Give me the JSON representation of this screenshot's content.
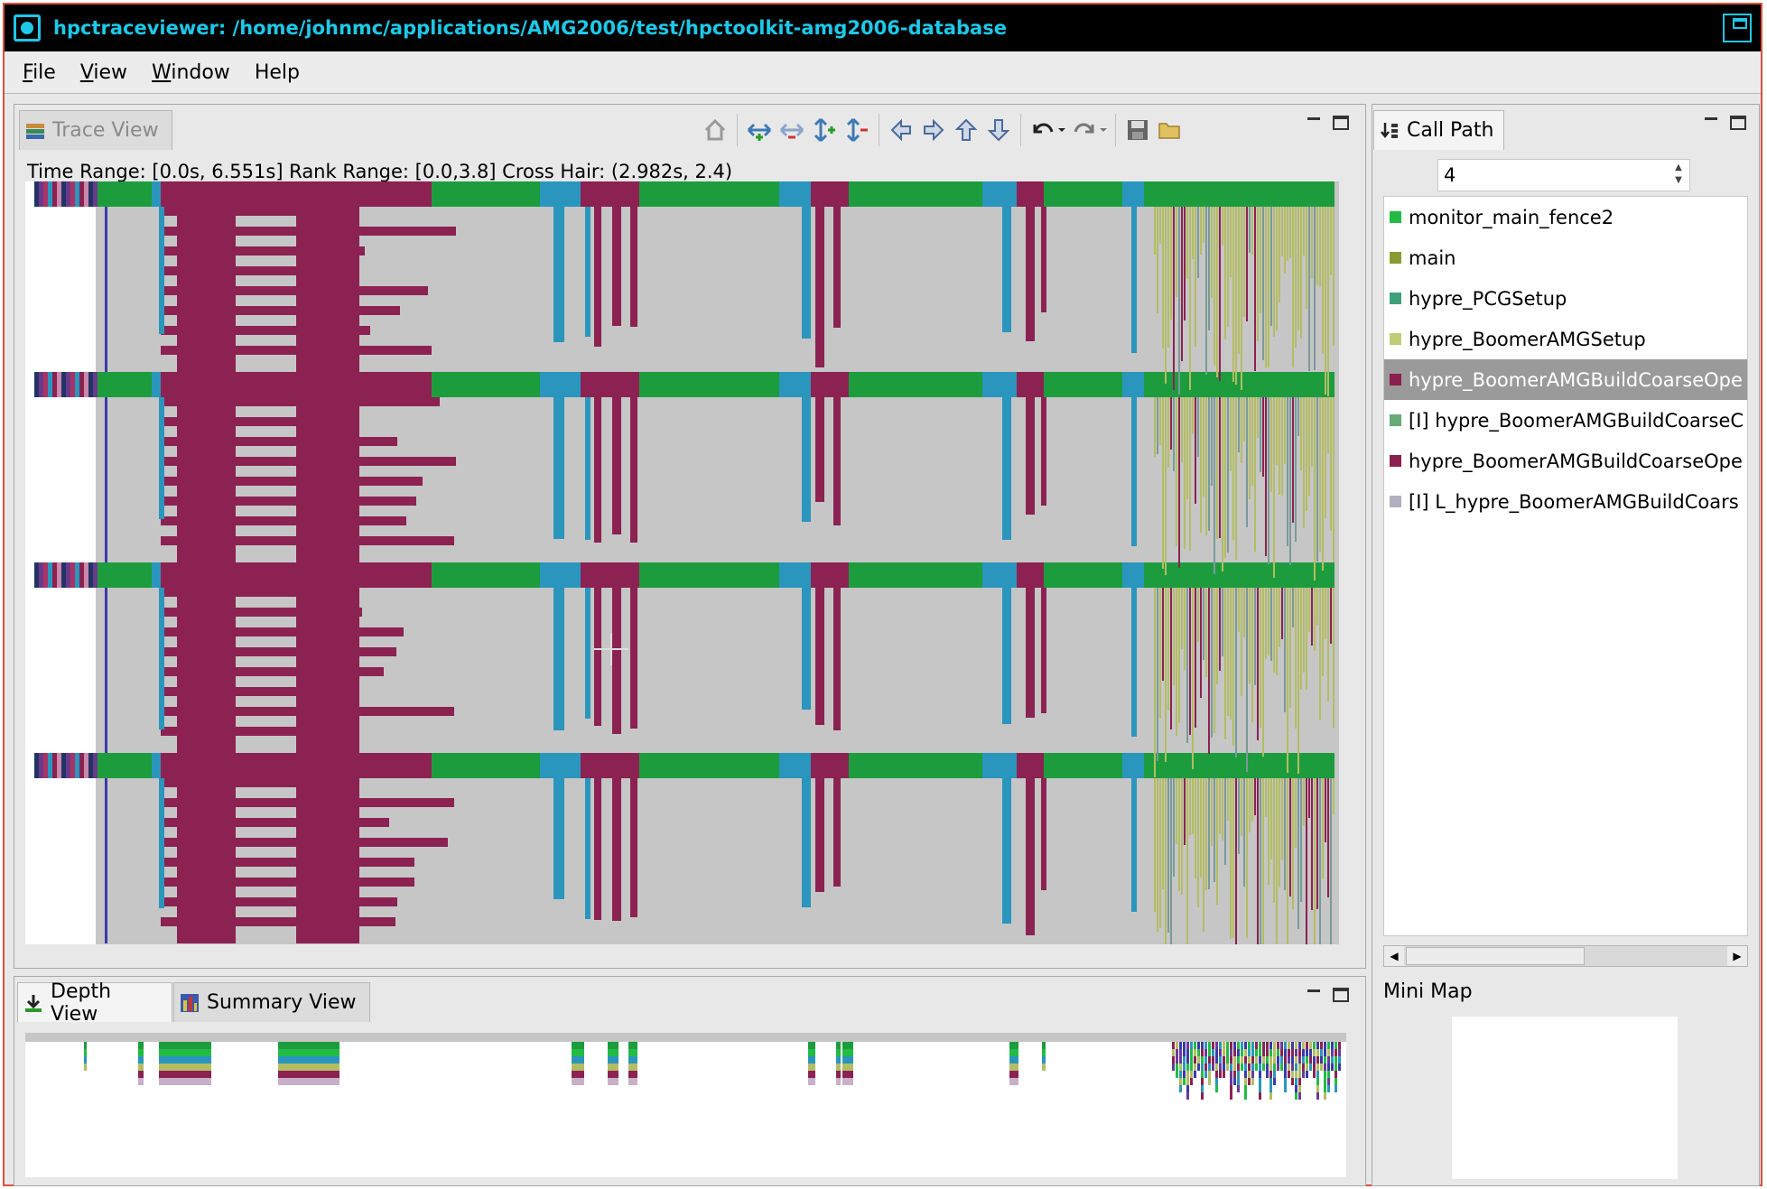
{
  "window": {
    "title": "hpctraceviewer: /home/johnmc/applications/AMG2006/test/hpctoolkit-amg2006-database"
  },
  "menu": [
    {
      "mnemonic": "F",
      "rest": "ile"
    },
    {
      "mnemonic": "V",
      "rest": "iew"
    },
    {
      "mnemonic": "W",
      "rest": "indow"
    },
    {
      "mnemonic": "",
      "rest": "Help"
    }
  ],
  "trace_view": {
    "tab_label": "Trace View",
    "info": "Time Range: [0.0s, 6.551s]  Rank Range: [0.0,3.8]  Cross Hair: (2.982s, 2.4)"
  },
  "lower_tabs": {
    "depth": "Depth View",
    "summary": "Summary View"
  },
  "call_path": {
    "tab_label": "Call Path",
    "depth_value": "4",
    "items": [
      {
        "label": "monitor_main_fence2",
        "color": "#22bb44",
        "selected": false
      },
      {
        "label": "main",
        "color": "#8a9b33",
        "selected": false
      },
      {
        "label": "hypre_PCGSetup",
        "color": "#3fa079",
        "selected": false
      },
      {
        "label": "hypre_BoomerAMGSetup",
        "color": "#c2cc77",
        "selected": false
      },
      {
        "label": "hypre_BoomerAMGBuildCoarseOpe",
        "color": "#8b1f4f",
        "selected": true
      },
      {
        "label": "[I] hypre_BoomerAMGBuildCoarseC",
        "color": "#66aa77",
        "selected": false
      },
      {
        "label": "hypre_BoomerAMGBuildCoarseOpe",
        "color": "#8b1f4f",
        "selected": false
      },
      {
        "label": "[I] L_hypre_BoomerAMGBuildCoars",
        "color": "#b0b0c0",
        "selected": false
      }
    ],
    "minimap_label": "Mini Map"
  },
  "colors": {
    "trace_bg": "#c6c6c6",
    "magenta": "#8b2252",
    "cyan": "#2a96bd",
    "green": "#1d9c3e",
    "olive": "#b4bd63"
  }
}
